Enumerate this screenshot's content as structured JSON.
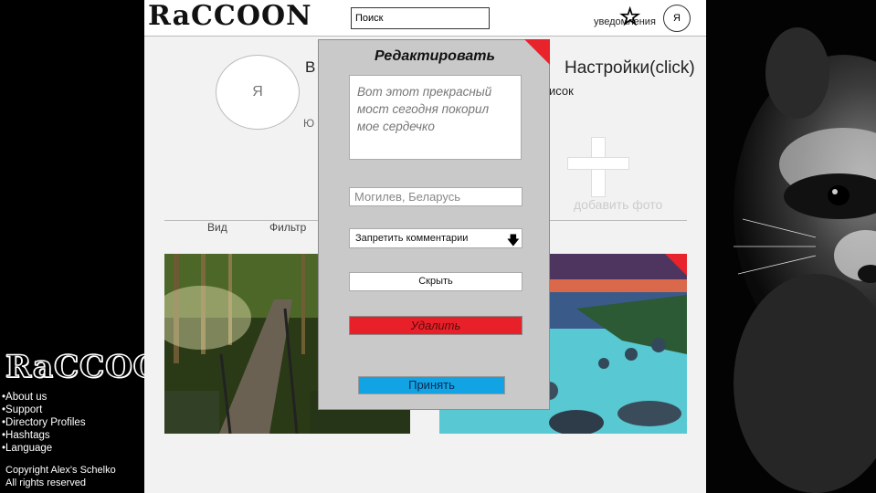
{
  "app": {
    "logo_text": "RaCCOON",
    "search_value": "Поиск",
    "notifications_label": "уведомления",
    "avatar_letter": "Я"
  },
  "profile": {
    "avatar_letter": "Я",
    "name_partial": "В",
    "sub_partial": "Ю",
    "settings_link": "Настройки(click)",
    "list_partial": "исок",
    "add_photo_label": "добавить фото"
  },
  "tabs": {
    "view": "Вид",
    "filter": "Фильтр"
  },
  "modal": {
    "title": "Редактировать",
    "description": "Вот этот прекрасный мост сегодня покорил мое сердечко",
    "location": "Могилев, Беларусь",
    "comments_option": "Запретить комментарии",
    "hide_label": "Скрыть",
    "delete_label": "Удалить",
    "accept_label": "Принять"
  },
  "sidebar": {
    "logo_text": "RaCCOON",
    "links": [
      "•About us",
      "•Support",
      "•Directory Profiles",
      "•Hashtags",
      "•Language"
    ],
    "copyright": "Copyright Alex's Schelko\nAll rights reserved"
  },
  "colors": {
    "delete": "#e8202a",
    "accept": "#12a3e5",
    "corner_accent": "#e8232b"
  }
}
